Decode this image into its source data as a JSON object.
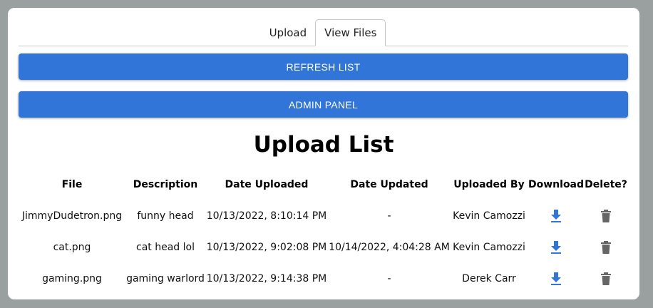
{
  "tabs": [
    {
      "label": "Upload",
      "active": false
    },
    {
      "label": "View Files",
      "active": true
    }
  ],
  "buttons": {
    "refresh": "REFRESH LIST",
    "admin": "ADMIN PANEL"
  },
  "heading": "Upload List",
  "table": {
    "headers": [
      "File",
      "Description",
      "Date Uploaded",
      "Date Updated",
      "Uploaded By",
      "Download",
      "Delete?"
    ],
    "rows": [
      {
        "file": "JimmyDudetron.png",
        "description": "funny head",
        "uploaded": "10/13/2022, 8:10:14 PM",
        "updated": "-",
        "by": "Kevin Camozzi"
      },
      {
        "file": "cat.png",
        "description": "cat head lol",
        "uploaded": "10/13/2022, 9:02:08 PM",
        "updated": "10/14/2022, 4:04:28 AM",
        "by": "Kevin Camozzi"
      },
      {
        "file": "gaming.png",
        "description": "gaming warlord",
        "uploaded": "10/13/2022, 9:14:38 PM",
        "updated": "-",
        "by": "Derek Carr"
      }
    ]
  },
  "icons": {
    "download": "download-icon",
    "delete": "trash-icon"
  },
  "colors": {
    "primary": "#3275d8",
    "background": "#9a9f9f",
    "card": "#ffffff",
    "download_icon": "#3275d8",
    "delete_icon": "#666666"
  }
}
